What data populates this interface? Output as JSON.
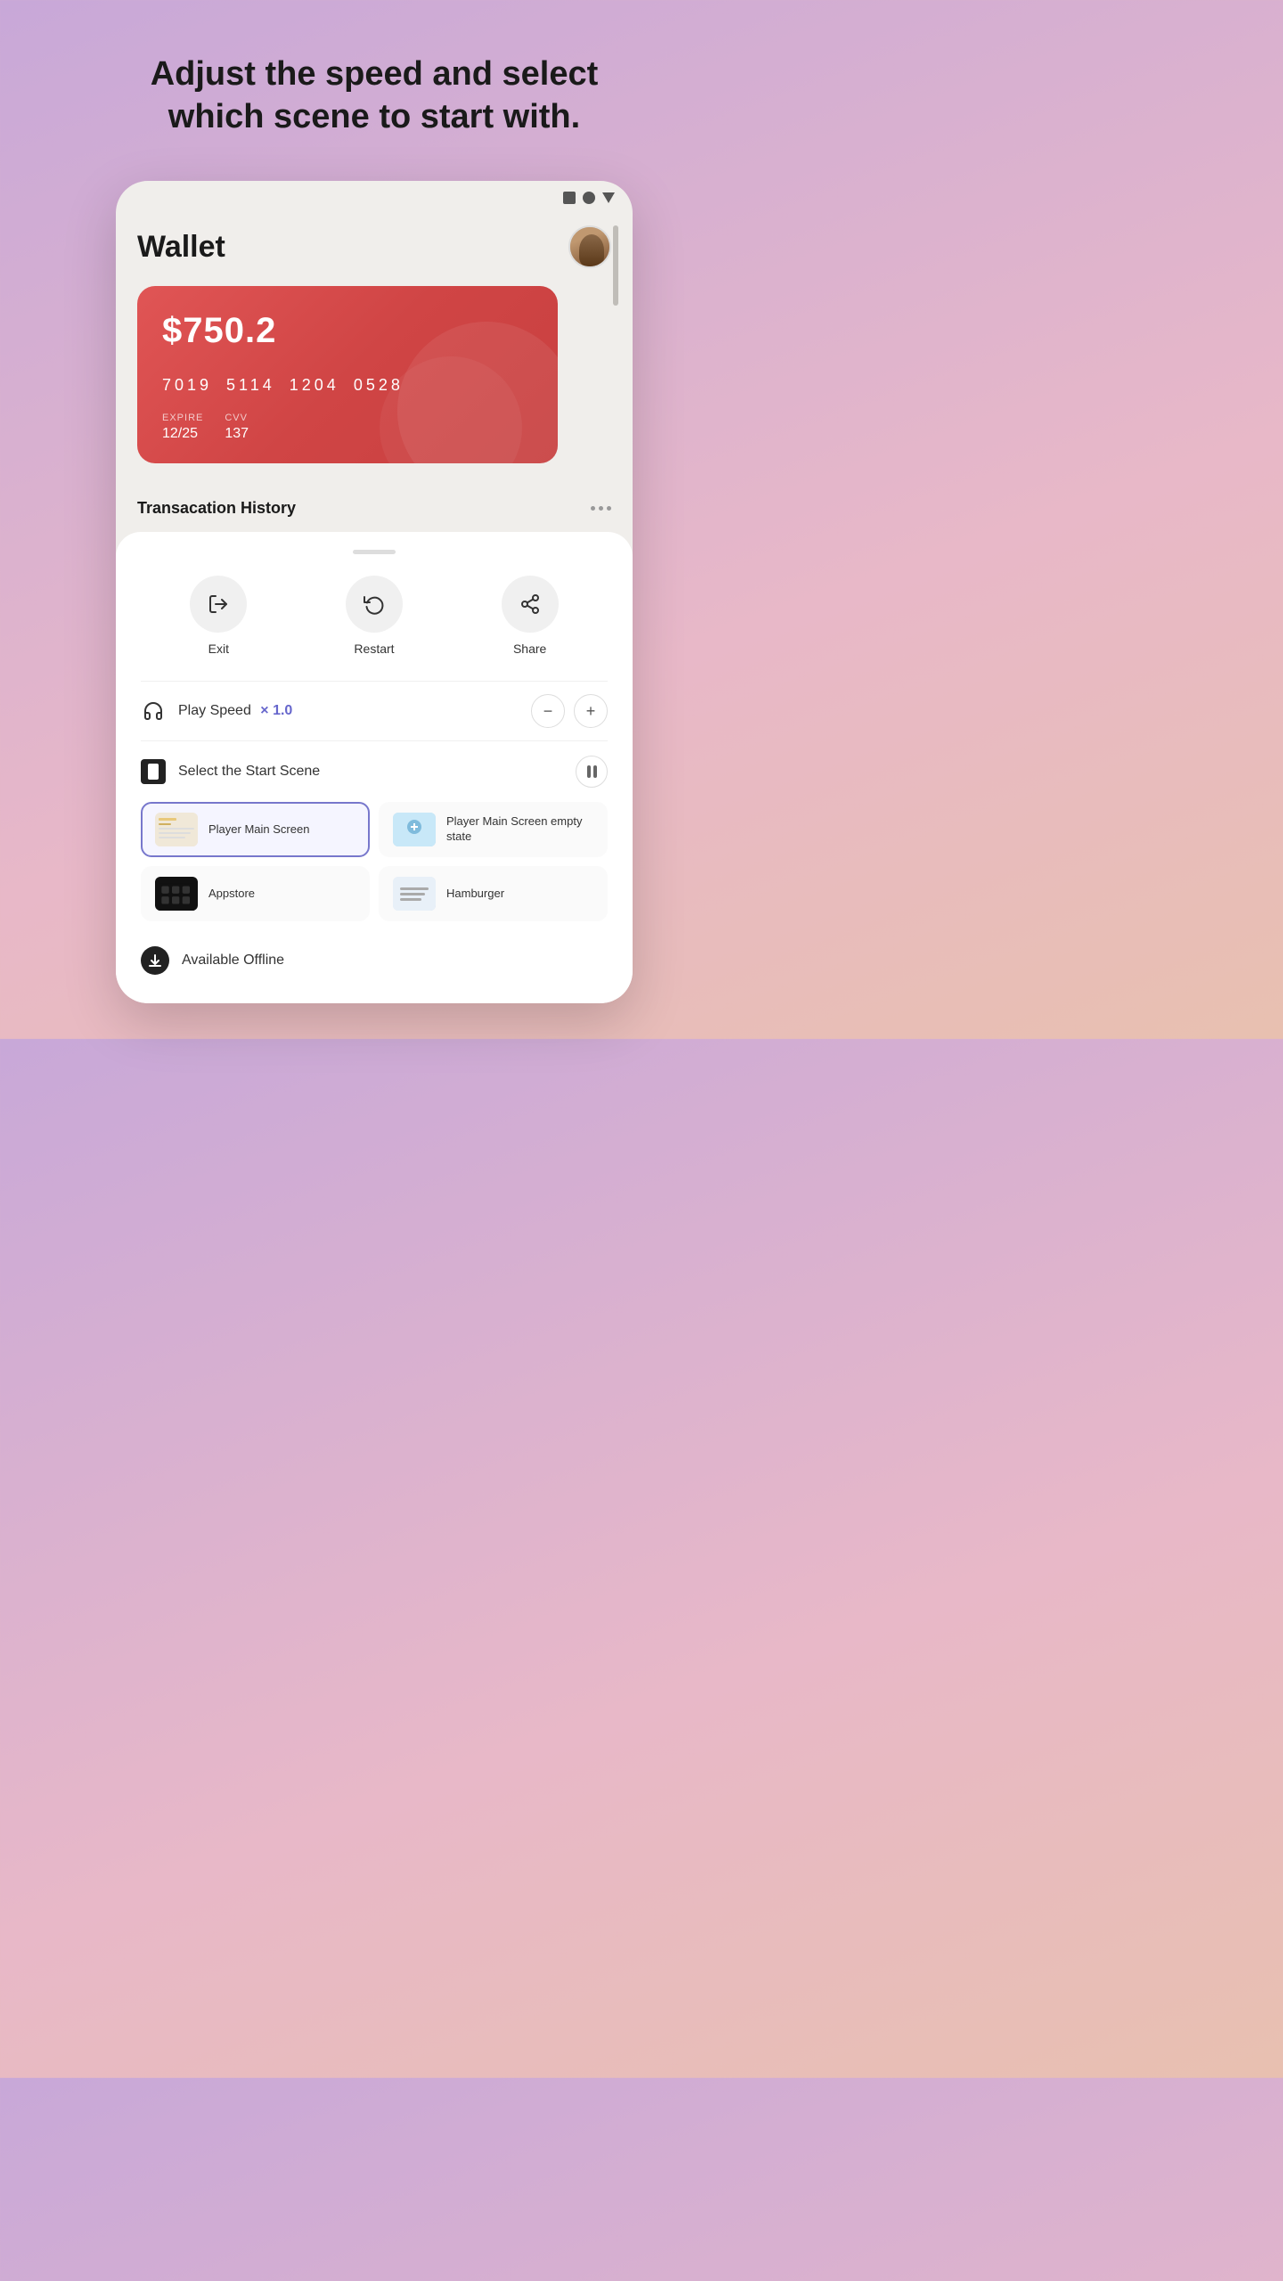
{
  "headline": {
    "line1": "Adjust the speed and select",
    "line2": "which scene to start with."
  },
  "wallet": {
    "title": "Wallet",
    "balance": "$750.2",
    "card_number": [
      "7019",
      "5114",
      "1204",
      "0528"
    ],
    "expire_label": "EXPIRE",
    "expire_value": "12/25",
    "cvv_label": "CVV",
    "cvv_value": "137",
    "transaction_title": "Transacation History"
  },
  "controls": {
    "exit_label": "Exit",
    "restart_label": "Restart",
    "share_label": "Share",
    "play_speed_label": "Play Speed",
    "play_speed_value": "× 1.0",
    "select_scene_label": "Select the Start Scene",
    "decrease_label": "−",
    "increase_label": "+"
  },
  "scenes": [
    {
      "name": "Player Main Screen",
      "active": true,
      "thumb_type": "main"
    },
    {
      "name": "Player Main Screen empty state",
      "active": false,
      "thumb_type": "empty"
    },
    {
      "name": "Appstore",
      "active": false,
      "thumb_type": "appstore"
    },
    {
      "name": "Hamburger",
      "active": false,
      "thumb_type": "hamburger"
    }
  ],
  "offline": {
    "label": "Available Offline"
  }
}
